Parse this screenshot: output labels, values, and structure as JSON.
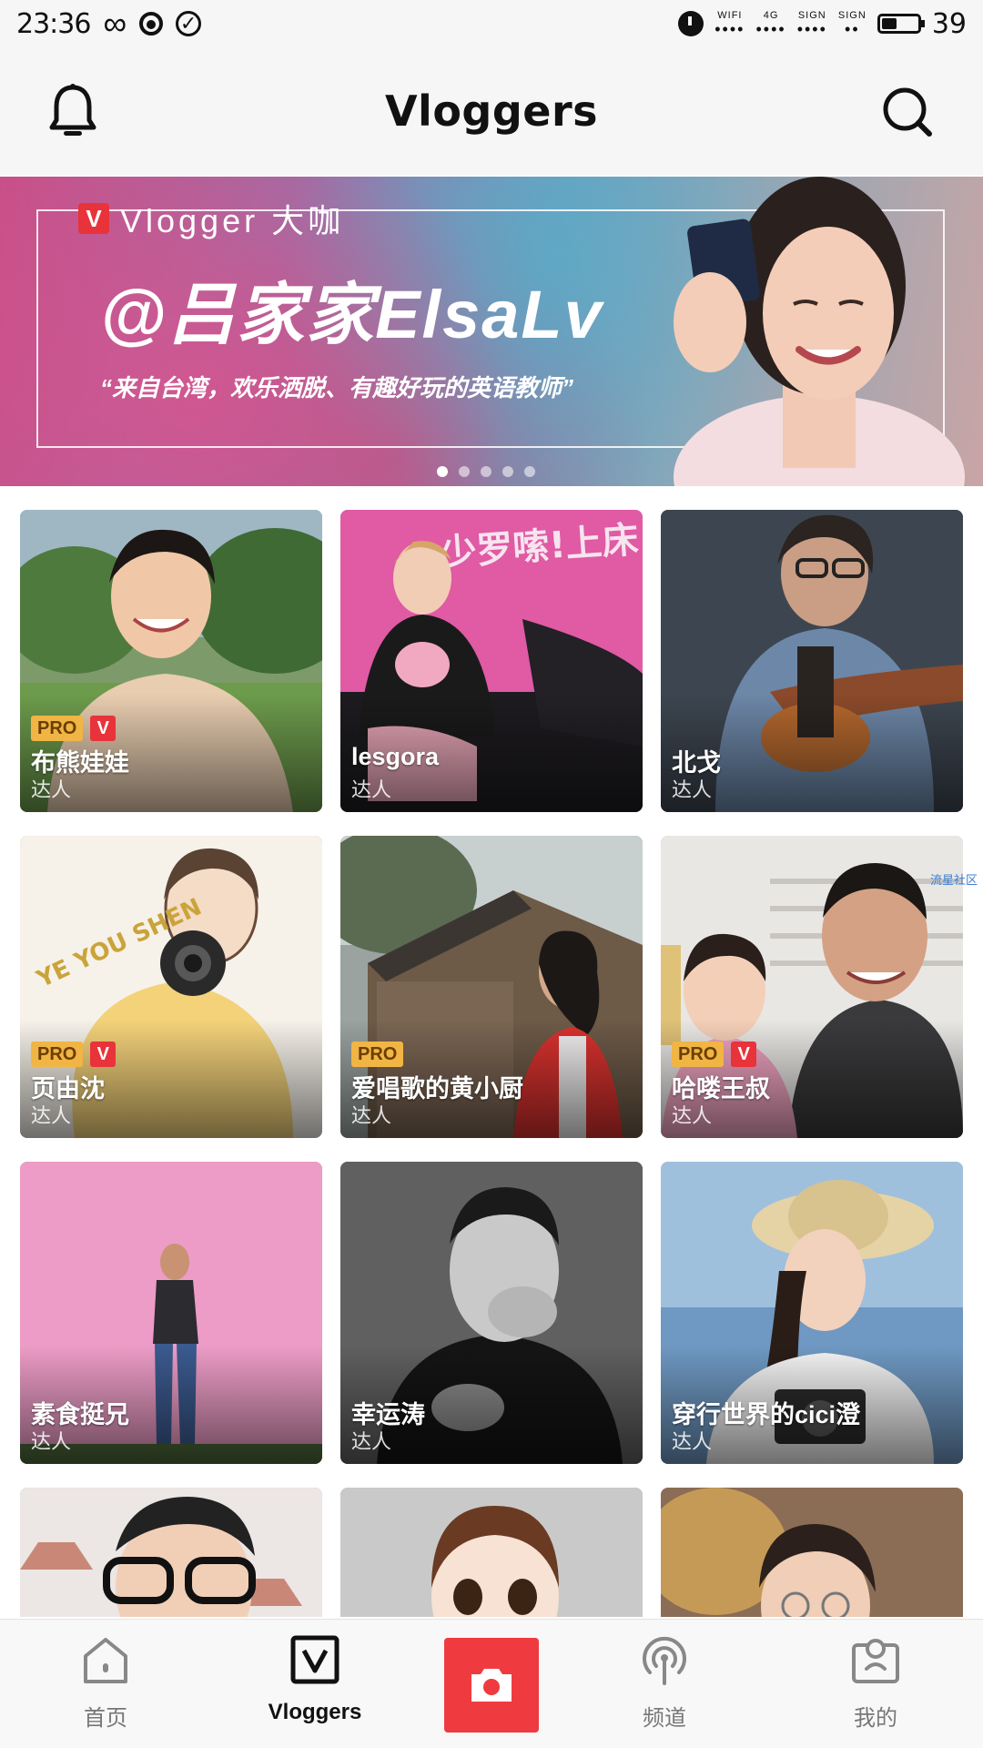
{
  "status_bar": {
    "time": "23:36",
    "wifi_label": "WIFI",
    "network_label": "4G",
    "sign_label_1": "SIGN",
    "sign_label_2": "SIGN",
    "battery": "39"
  },
  "header": {
    "title": "Vloggers",
    "left_icon": "bell-icon",
    "right_icon": "search-icon"
  },
  "banner": {
    "tag_badge": "V",
    "tag_text": "Vlogger 大咖",
    "name": "@吕家家ElsaLv",
    "quote": "“来自台湾，欢乐洒脱、有趣好玩的英语教师”",
    "slide_count": 5,
    "active_slide": 1
  },
  "cards": [
    {
      "name": "布熊娃娃",
      "role": "达人",
      "pro": "PRO",
      "v": "V"
    },
    {
      "name": "lesgora",
      "role": "达人",
      "pro": "",
      "v": ""
    },
    {
      "name": "北戈",
      "role": "达人",
      "pro": "",
      "v": ""
    },
    {
      "name": "页由沈",
      "role": "达人",
      "pro": "PRO",
      "v": "V"
    },
    {
      "name": "爱唱歌的黄小厨",
      "role": "达人",
      "pro": "PRO",
      "v": ""
    },
    {
      "name": "哈喽王叔",
      "role": "达人",
      "pro": "PRO",
      "v": "V"
    },
    {
      "name": "素食挺兄",
      "role": "达人",
      "pro": "",
      "v": ""
    },
    {
      "name": "幸运涛",
      "role": "达人",
      "pro": "",
      "v": ""
    },
    {
      "name": "穿行世界的cici澄",
      "role": "达人",
      "pro": "",
      "v": ""
    },
    {
      "name": "",
      "role": "",
      "pro": "",
      "v": ""
    },
    {
      "name": "",
      "role": "",
      "pro": "",
      "v": ""
    },
    {
      "name": "",
      "role": "",
      "pro": "",
      "v": ""
    }
  ],
  "side_watermark": "流星社区",
  "bottom_nav": {
    "items": [
      {
        "label": "首页",
        "icon": "home-icon"
      },
      {
        "label": "Vloggers",
        "icon": "vloggers-icon"
      },
      {
        "label": "",
        "icon": "camera-icon"
      },
      {
        "label": "频道",
        "icon": "channel-icon"
      },
      {
        "label": "我的",
        "icon": "profile-icon"
      }
    ],
    "active": 1
  },
  "colors": {
    "accent_red": "#ef3b3f",
    "pro_badge": "#f0b544",
    "v_badge": "#e8333a"
  }
}
